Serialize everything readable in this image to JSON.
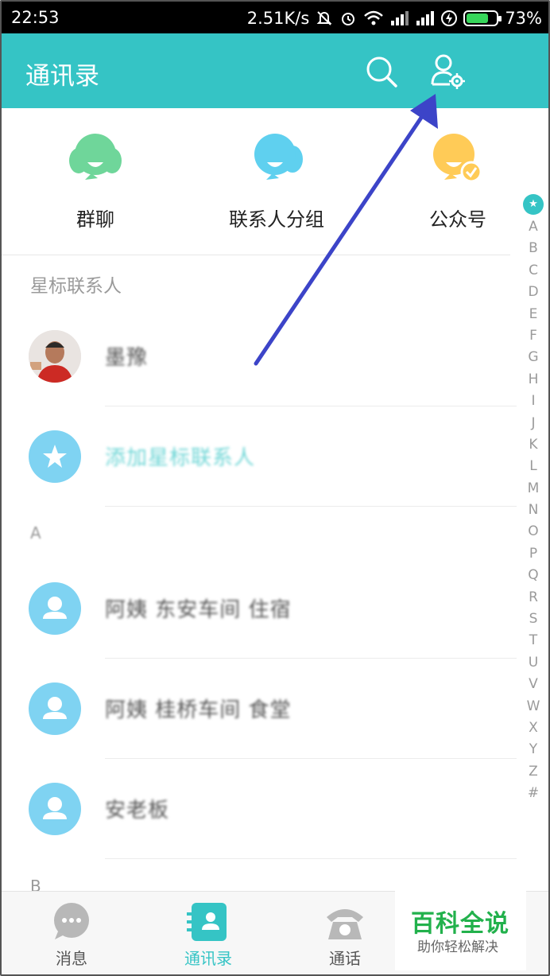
{
  "status_bar": {
    "time": "22:53",
    "net_speed": "2.51K/s",
    "battery": "73%",
    "battery_level": 0.73
  },
  "header": {
    "title": "通讯录",
    "search_icon": "search-icon",
    "settings_icon": "contact-settings-icon"
  },
  "quick_access": [
    {
      "label": "群聊",
      "icon": "group-chat-icon",
      "color": "#6fd69a"
    },
    {
      "label": "联系人分组",
      "icon": "contact-group-icon",
      "color": "#5fd0ef"
    },
    {
      "label": "公众号",
      "icon": "official-account-icon",
      "color": "#ffcb57"
    }
  ],
  "sections": {
    "starred": "星标联系人",
    "a": "A",
    "b": "B"
  },
  "contacts": {
    "starred_contact": "墨豫",
    "add_starred": "添加星标联系人",
    "a1": "阿姨 东安车间 住宿",
    "a2": "阿姨 桂桥车间 食堂",
    "a3": "安老板"
  },
  "index": {
    "star": "★",
    "letters": [
      "A",
      "B",
      "C",
      "D",
      "E",
      "F",
      "G",
      "H",
      "I",
      "J",
      "K",
      "L",
      "M",
      "N",
      "O",
      "P",
      "Q",
      "R",
      "S",
      "T",
      "U",
      "V",
      "W",
      "X",
      "Y",
      "Z",
      "#"
    ]
  },
  "bottom_nav": [
    {
      "label": "消息",
      "icon": "message-icon"
    },
    {
      "label": "通讯录",
      "icon": "contacts-icon",
      "active": true
    },
    {
      "label": "通话",
      "icon": "phone-icon"
    }
  ],
  "watermark": {
    "title": "百科全说",
    "subtitle": "助你轻松解决"
  },
  "colors": {
    "accent": "#35c4c5",
    "arrow": "#3c44c8"
  }
}
